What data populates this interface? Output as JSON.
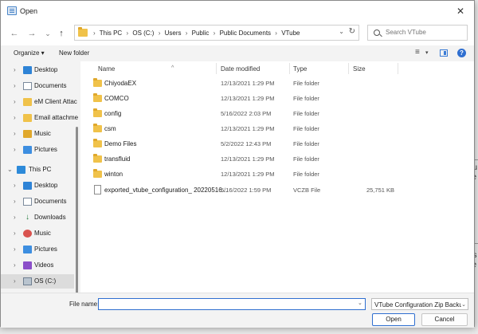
{
  "window": {
    "title": "Open",
    "close_glyph": "✕"
  },
  "nav": {
    "back_glyph": "←",
    "forward_glyph": "→",
    "recent_glyph": "⌄",
    "up_glyph": "↑",
    "breadcrumb": [
      "This PC",
      "OS (C:)",
      "Users",
      "Public",
      "Public Documents",
      "VTube"
    ],
    "search_placeholder": "Search VTube"
  },
  "toolbar": {
    "organize_label": "Organize ▾",
    "new_folder_label": "New folder",
    "view_glyph": "≡",
    "view_drop": "▾",
    "help_glyph": "?"
  },
  "sidebar": {
    "items": [
      {
        "label": "Desktop",
        "icon": "desktop-icon",
        "chev": "›"
      },
      {
        "label": "Documents",
        "icon": "documents-icon",
        "chev": "›"
      },
      {
        "label": "eM Client Attac",
        "icon": "folder-icon",
        "chev": "›"
      },
      {
        "label": "Email attachme",
        "icon": "folder-icon",
        "chev": "›"
      },
      {
        "label": "Music",
        "icon": "music-folder-icon",
        "chev": "›"
      },
      {
        "label": "Pictures",
        "icon": "pictures-icon",
        "chev": "›"
      },
      {
        "label": "This PC",
        "icon": "pc-icon",
        "chev": "⌄"
      },
      {
        "label": "Desktop",
        "icon": "desktop-icon",
        "chev": "›"
      },
      {
        "label": "Documents",
        "icon": "documents-icon",
        "chev": "›"
      },
      {
        "label": "Downloads",
        "icon": "downloads-icon",
        "chev": "›"
      },
      {
        "label": "Music",
        "icon": "music-icon",
        "chev": "›"
      },
      {
        "label": "Pictures",
        "icon": "pictures-icon",
        "chev": "›"
      },
      {
        "label": "Videos",
        "icon": "videos-icon",
        "chev": "›"
      },
      {
        "label": "OS (C:)",
        "icon": "drive-icon",
        "chev": "›"
      }
    ]
  },
  "columns": {
    "name": "Name",
    "date": "Date modified",
    "type": "Type",
    "size": "Size"
  },
  "files": [
    {
      "name": "ChiyodaEX",
      "date": "12/13/2021 1:29 PM",
      "type": "File folder",
      "size": "",
      "kind": "folder"
    },
    {
      "name": "COMCO",
      "date": "12/13/2021 1:29 PM",
      "type": "File folder",
      "size": "",
      "kind": "folder"
    },
    {
      "name": "config",
      "date": "5/16/2022 2:03 PM",
      "type": "File folder",
      "size": "",
      "kind": "folder"
    },
    {
      "name": "csm",
      "date": "12/13/2021 1:29 PM",
      "type": "File folder",
      "size": "",
      "kind": "folder"
    },
    {
      "name": "Demo Files",
      "date": "5/2/2022 12:43 PM",
      "type": "File folder",
      "size": "",
      "kind": "folder"
    },
    {
      "name": "transfluid",
      "date": "12/13/2021 1:29 PM",
      "type": "File folder",
      "size": "",
      "kind": "folder"
    },
    {
      "name": "winton",
      "date": "12/13/2021 1:29 PM",
      "type": "File folder",
      "size": "",
      "kind": "folder"
    },
    {
      "name": "exported_vtube_configuration_ 20220516...",
      "date": "5/16/2022 1:59 PM",
      "type": "VCZB File",
      "size": "25,751 KB",
      "kind": "file"
    }
  ],
  "bottom": {
    "file_name_label": "File name:",
    "file_name_value": "",
    "file_type": "VTube Configuration Zip Backu",
    "open_label": "Open",
    "cancel_label": "Cancel"
  },
  "background_peek": {
    "text1": "gu\nile",
    "text2": "es\nile"
  }
}
